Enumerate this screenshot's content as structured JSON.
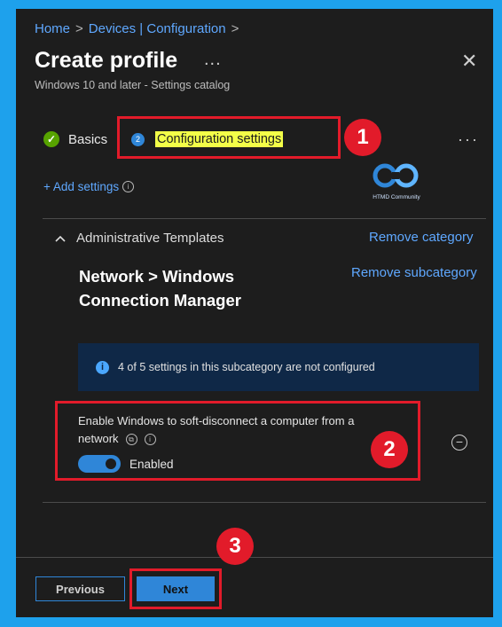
{
  "breadcrumb": {
    "home": "Home",
    "sep": ">",
    "devices": "Devices | Configuration"
  },
  "header": {
    "title": "Create profile",
    "more": "...",
    "close": "✕",
    "subtitle": "Windows 10 and later - Settings catalog"
  },
  "tabs": {
    "basics": {
      "label": "Basics",
      "icon": "check-icon",
      "color": "#57a300"
    },
    "config": {
      "step": "2",
      "label": "Configuration settings",
      "highlight": "#f3ff48"
    },
    "more": "···"
  },
  "callouts": {
    "one": "1",
    "two": "2",
    "three": "3",
    "color": "#e21b2a"
  },
  "logo": {
    "text": "HTMD Community"
  },
  "add_settings": {
    "label": "+ Add settings"
  },
  "category": {
    "name": "Administrative Templates",
    "remove": "Remove category"
  },
  "subcategory": {
    "name": "Network > Windows Connection Manager",
    "remove": "Remove subcategory"
  },
  "info": {
    "text": "4 of 5 settings in this subcategory are not configured"
  },
  "setting": {
    "label": "Enable Windows to soft-disconnect a computer from a network",
    "toggle_label": "Enabled",
    "toggle_on": true
  },
  "footer": {
    "previous": "Previous",
    "next": "Next"
  },
  "colors": {
    "accent": "#2f86d8",
    "panel": "#1d1d1d",
    "border": "#1ea1ec",
    "link": "#5fa8ff"
  }
}
